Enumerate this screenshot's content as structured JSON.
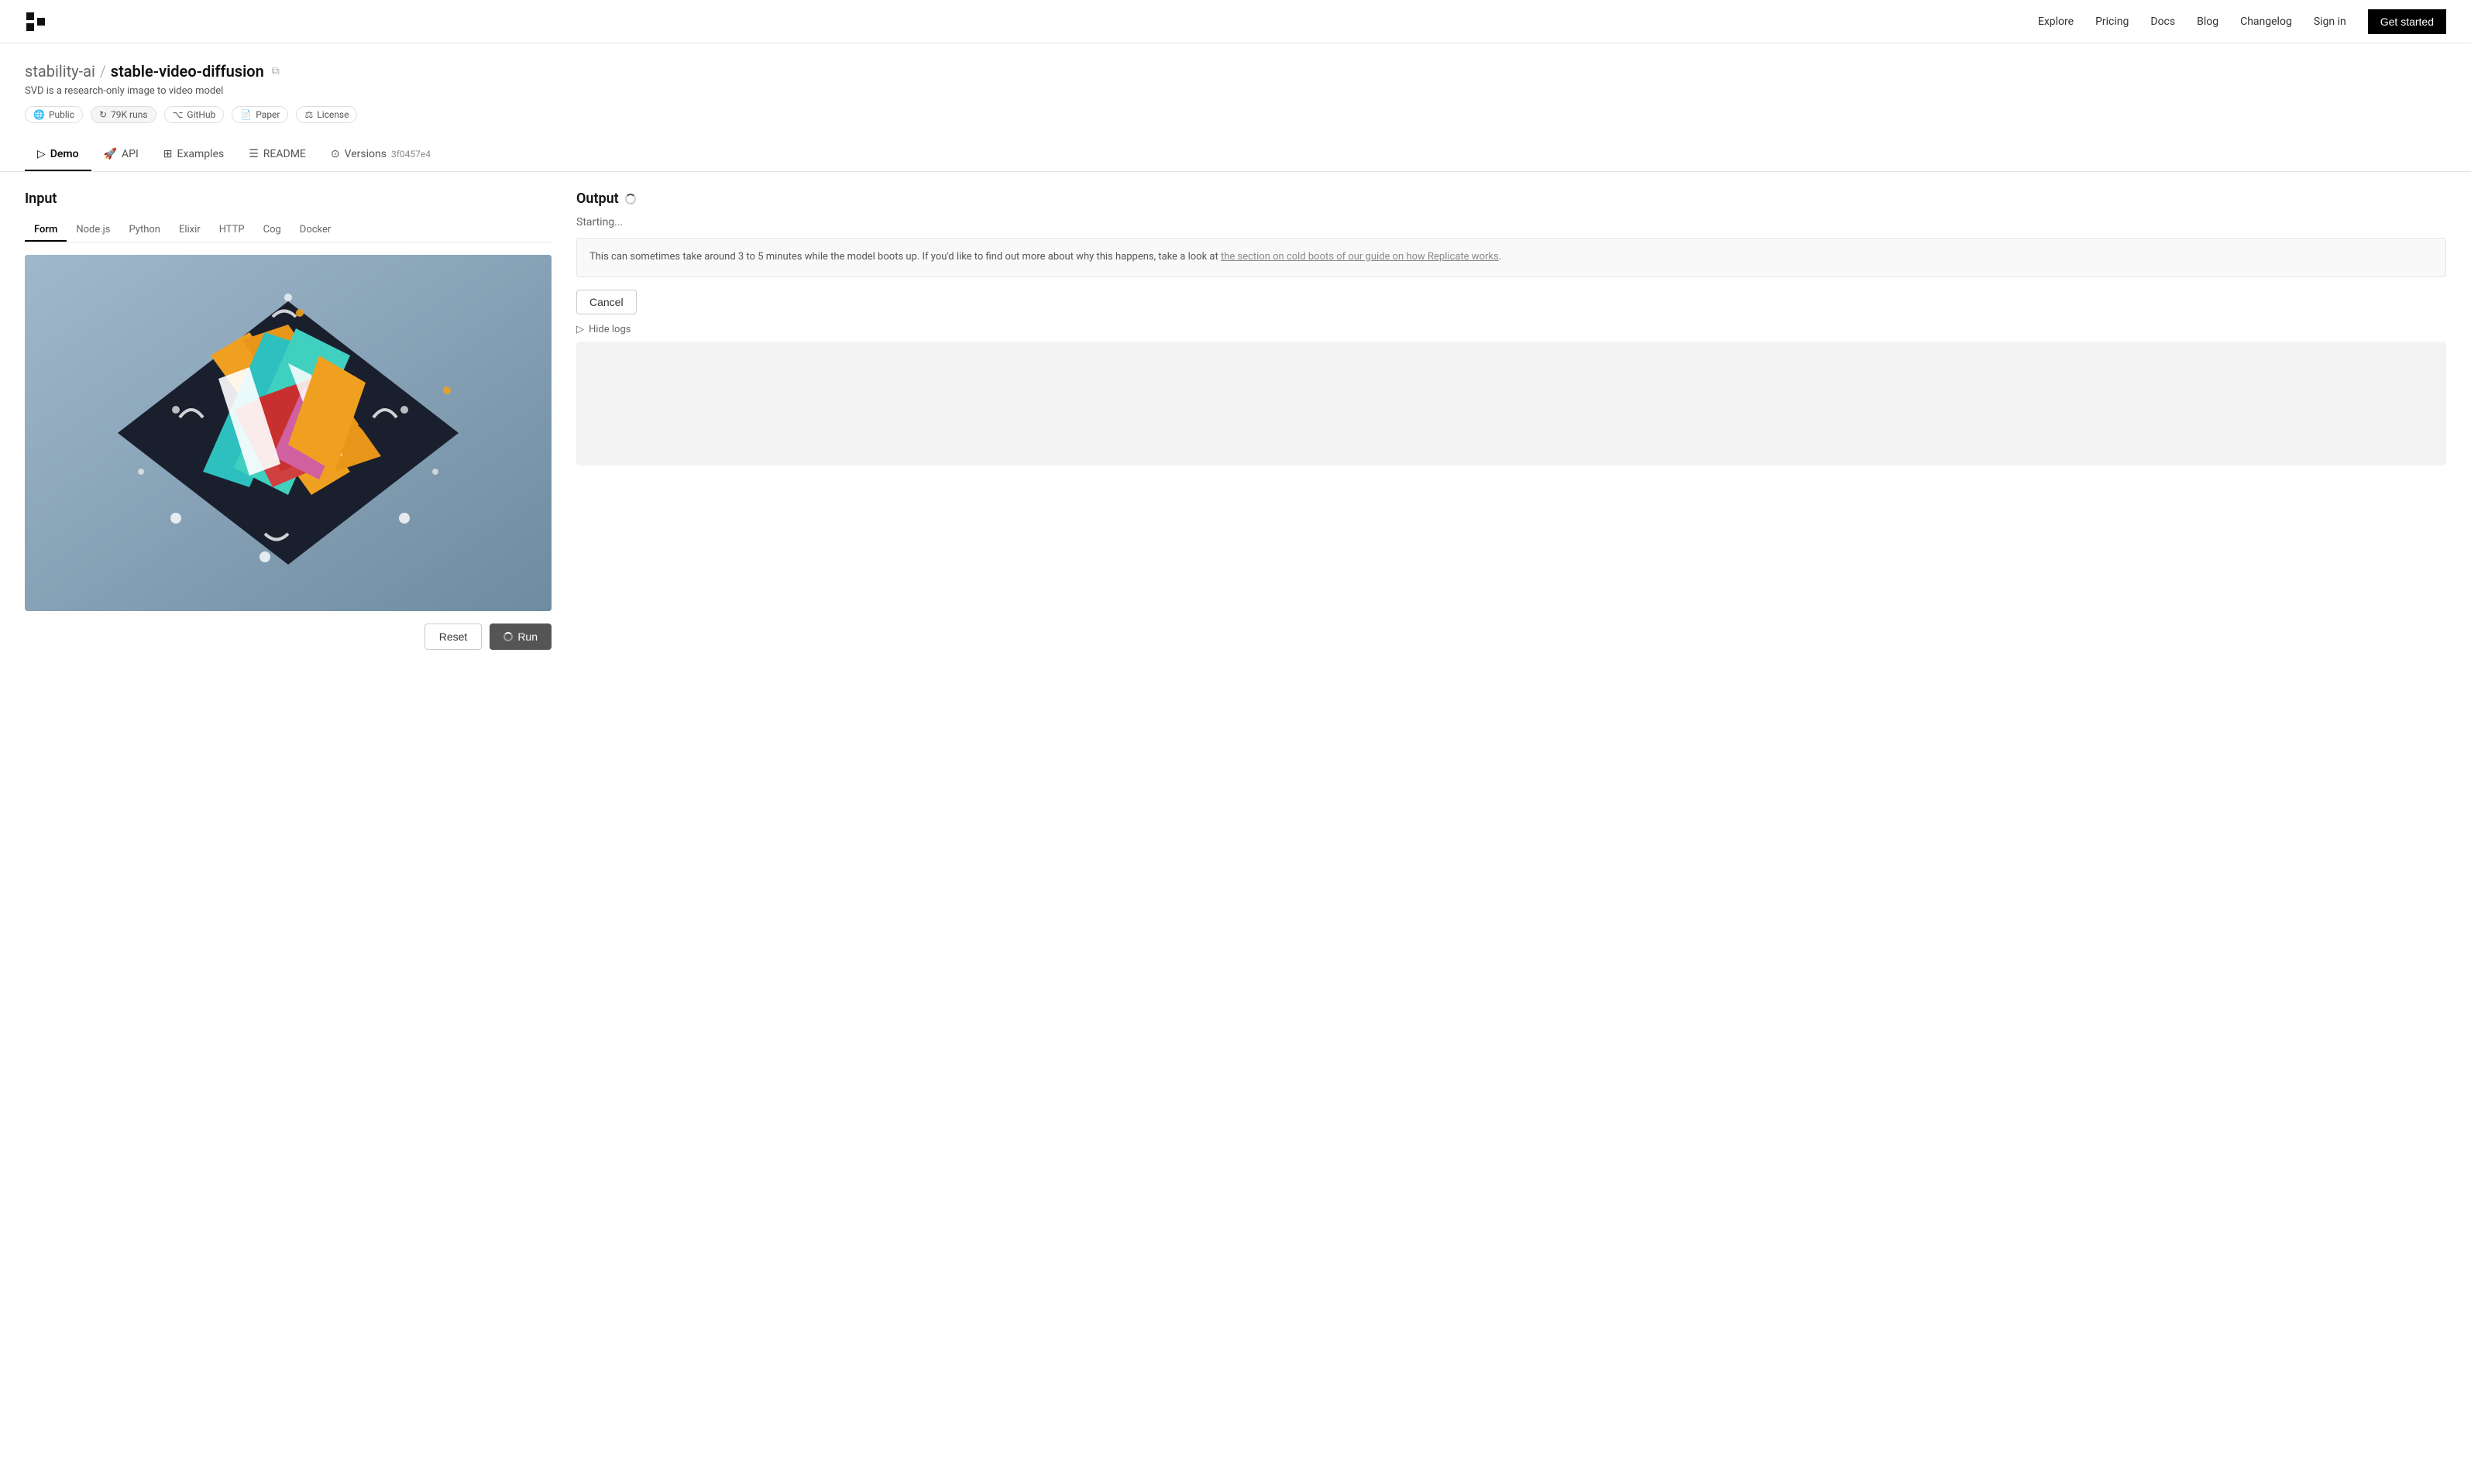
{
  "nav": {
    "logo_alt": "Replicate logo",
    "links": [
      "Explore",
      "Pricing",
      "Docs",
      "Blog",
      "Changelog",
      "Sign in"
    ],
    "cta": "Get started"
  },
  "header": {
    "org": "stability-ai",
    "separator": "/",
    "model": "stable-video-diffusion",
    "description": "SVD is a research-only image to video model",
    "badges": [
      {
        "label": "Public",
        "icon": "globe"
      },
      {
        "label": "79K runs",
        "icon": "refresh"
      },
      {
        "label": "GitHub",
        "icon": "github"
      },
      {
        "label": "Paper",
        "icon": "doc"
      },
      {
        "label": "License",
        "icon": "shield"
      }
    ]
  },
  "tabs": [
    {
      "label": "Demo",
      "icon": "play",
      "active": true
    },
    {
      "label": "API",
      "icon": "api"
    },
    {
      "label": "Examples",
      "icon": "examples"
    },
    {
      "label": "README",
      "icon": "readme"
    },
    {
      "label": "Versions",
      "icon": "versions",
      "version": "3f0457e4"
    }
  ],
  "input": {
    "title": "Input",
    "code_tabs": [
      "Form",
      "Node.js",
      "Python",
      "Elixir",
      "HTTP",
      "Cog",
      "Docker"
    ],
    "active_code_tab": "Form"
  },
  "actions": {
    "reset_label": "Reset",
    "run_label": "Run"
  },
  "output": {
    "title": "Output",
    "starting_text": "Starting...",
    "info_text": "This can sometimes take around 3 to 5 minutes while the model boots up. If you'd like to find out more about why this happens, take a look at",
    "info_link_text": "the section on cold boots of our guide on how Replicate works",
    "cancel_label": "Cancel",
    "hide_logs_label": "Hide logs"
  }
}
